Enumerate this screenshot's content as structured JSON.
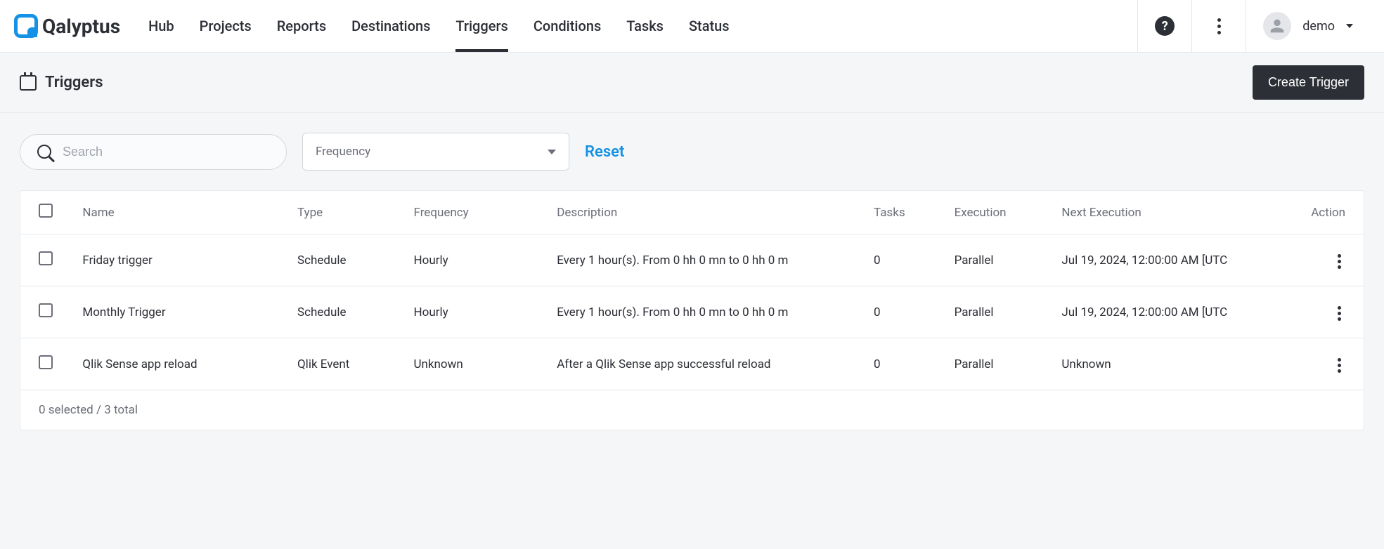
{
  "brand": "Qalyptus",
  "nav": {
    "items": [
      {
        "label": "Hub",
        "active": false
      },
      {
        "label": "Projects",
        "active": false
      },
      {
        "label": "Reports",
        "active": false
      },
      {
        "label": "Destinations",
        "active": false
      },
      {
        "label": "Triggers",
        "active": true
      },
      {
        "label": "Conditions",
        "active": false
      },
      {
        "label": "Tasks",
        "active": false
      },
      {
        "label": "Status",
        "active": false
      }
    ]
  },
  "user": {
    "name": "demo"
  },
  "page": {
    "title": "Triggers",
    "create_label": "Create Trigger"
  },
  "filters": {
    "search_placeholder": "Search",
    "frequency_label": "Frequency",
    "reset_label": "Reset"
  },
  "table": {
    "columns": {
      "name": "Name",
      "type": "Type",
      "frequency": "Frequency",
      "description": "Description",
      "tasks": "Tasks",
      "execution": "Execution",
      "next_execution": "Next Execution",
      "action": "Action"
    },
    "rows": [
      {
        "name": "Friday trigger",
        "type": "Schedule",
        "frequency": "Hourly",
        "description": "Every 1 hour(s). From 0 hh 0 mn to 0 hh 0 mn",
        "tasks": "0",
        "execution": "Parallel",
        "next_execution": "Jul 19, 2024, 12:00:00 AM [UTC"
      },
      {
        "name": "Monthly Trigger",
        "type": "Schedule",
        "frequency": "Hourly",
        "description": "Every 1 hour(s). From 0 hh 0 mn to 0 hh 0 mn",
        "tasks": "0",
        "execution": "Parallel",
        "next_execution": "Jul 19, 2024, 12:00:00 AM [UTC"
      },
      {
        "name": "Qlik Sense app reload",
        "type": "Qlik Event",
        "frequency": "Unknown",
        "description": "After a Qlik Sense app successful reload",
        "tasks": "0",
        "execution": "Parallel",
        "next_execution": "Unknown"
      }
    ],
    "footer": "0 selected / 3 total"
  }
}
